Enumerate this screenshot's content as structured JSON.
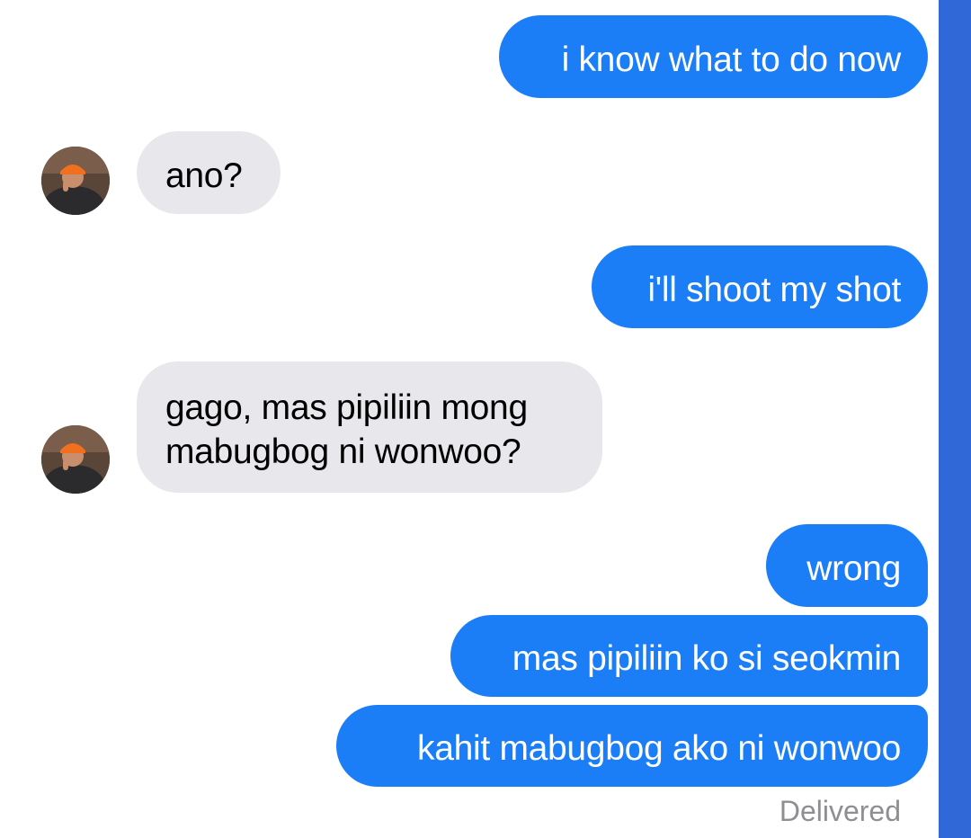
{
  "messages": [
    {
      "direction": "outgoing",
      "text": "i know what to do now"
    },
    {
      "direction": "incoming",
      "text": "ano?"
    },
    {
      "direction": "outgoing",
      "text": "i'll shoot my shot"
    },
    {
      "direction": "incoming",
      "lines": [
        "gago, mas pipiliin mong",
        "mabugbog ni wonwoo?"
      ]
    },
    {
      "direction": "outgoing",
      "text": "wrong"
    },
    {
      "direction": "outgoing",
      "text": "mas pipiliin ko si seokmin"
    },
    {
      "direction": "outgoing",
      "text": "kahit mabugbog ako ni wonwoo"
    }
  ],
  "status": {
    "delivered_label": "Delivered"
  },
  "colors": {
    "outgoing_bubble": "#1b7ef6",
    "incoming_bubble": "#e7e7ec",
    "side_strip": "#3168d8",
    "status_text": "#8e8e93"
  },
  "icons": {
    "contact_avatar": "contact-avatar-photo"
  }
}
